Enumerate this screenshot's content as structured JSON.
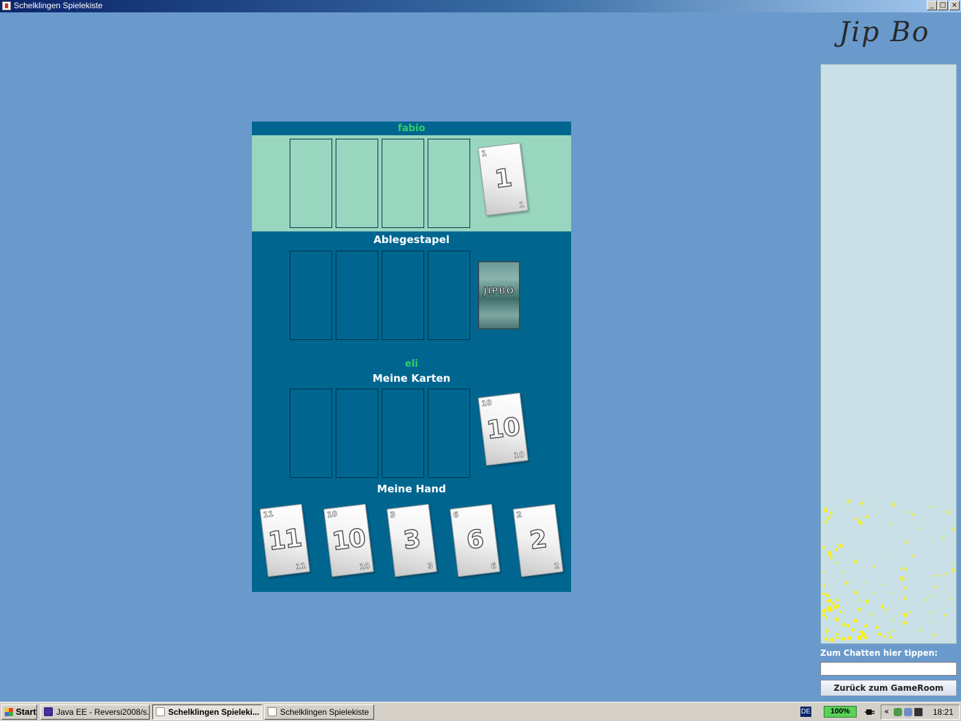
{
  "window": {
    "title": "Schelklingen Spielekiste",
    "controls": [
      "_",
      "□",
      "×"
    ]
  },
  "board": {
    "opponent": {
      "name": "fabio",
      "stock_card": "1"
    },
    "discard_title": "Ablegestapel",
    "deck_label": "JIPBO",
    "player": {
      "name": "eli",
      "cards_title": "Meine Karten",
      "stock_card": "10",
      "hand_title": "Meine Hand",
      "hand": [
        "11",
        "10",
        "3",
        "6",
        "2"
      ]
    }
  },
  "sidebar": {
    "logo_text": "Jip Bo",
    "chat_label": "Zum Chatten hier tippen:",
    "chat_input_value": "",
    "back_button": "Zurück zum GameRoom"
  },
  "taskbar": {
    "start": "Start",
    "tasks": [
      {
        "label": "Java EE - Reversi2008/s...",
        "active": false
      },
      {
        "label": "Schelklingen Spieleki...",
        "active": true
      },
      {
        "label": "Schelklingen Spielekiste",
        "active": false
      }
    ],
    "language": "DE",
    "battery": "100%",
    "tray_arrows": "«",
    "clock": "18:21"
  },
  "colors": {
    "desktop": "#6a9acc",
    "board": "#006690",
    "opponent_area": "#99d6bf",
    "player_name": "#33cc66"
  }
}
